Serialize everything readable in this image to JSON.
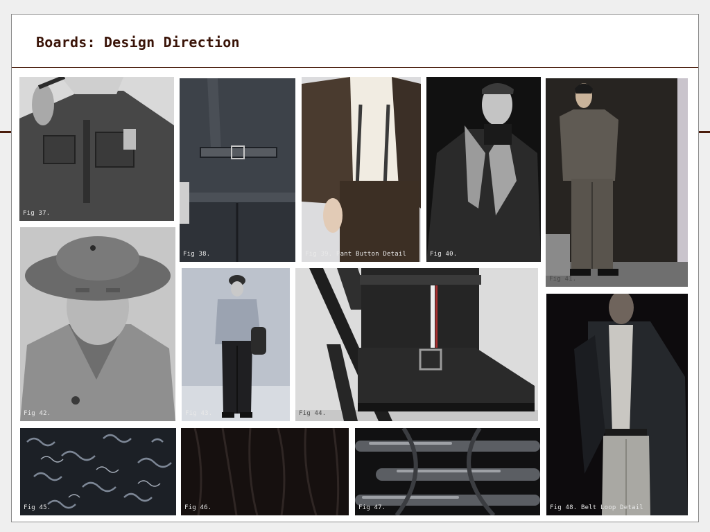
{
  "board": {
    "title": "Boards: Design Direction"
  },
  "figures": [
    {
      "caption": "Fig 37.",
      "subject": "man in work jacket with pipe"
    },
    {
      "caption": "Fig 38.",
      "subject": "denim back with cinch belt"
    },
    {
      "caption": "Fig 39. Pant Button Detail",
      "subject": "suspenders and brown jacket"
    },
    {
      "caption": "Fig 40.",
      "subject": "man in dark coat with grey collar"
    },
    {
      "caption": "Fig 41.",
      "subject": "man in olive suit standing"
    },
    {
      "caption": "Fig 42.",
      "subject": "man in bucket hat portrait"
    },
    {
      "caption": "Fig 43.",
      "subject": "man in cap and wide trousers"
    },
    {
      "caption": "Fig 44.",
      "subject": "boot on folding chair"
    },
    {
      "caption": "Fig 45.",
      "subject": "curly wool texture"
    },
    {
      "caption": "Fig 46.",
      "subject": "dark striated fabric"
    },
    {
      "caption": "Fig 47.",
      "subject": "woven leather strands"
    },
    {
      "caption": "Fig 48. Belt Loop Detail",
      "subject": "man in dark jacket and light trousers"
    }
  ]
}
